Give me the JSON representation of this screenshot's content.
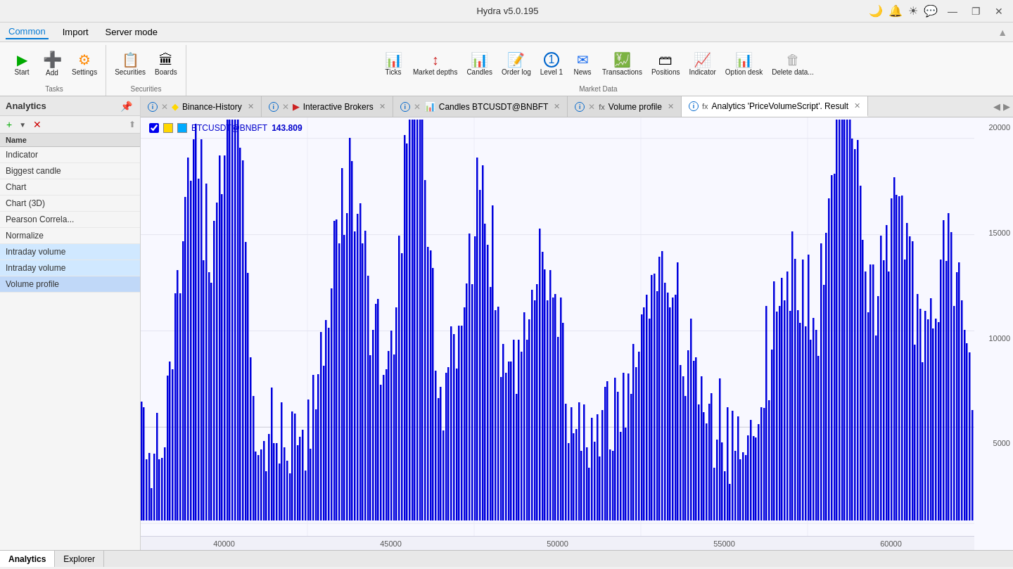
{
  "window": {
    "title": "Hydra v5.0.195"
  },
  "title_bar": {
    "icons": [
      "🌙",
      "🔔",
      "☀",
      "💬"
    ],
    "buttons": [
      "—",
      "❐",
      "✕"
    ]
  },
  "menu": {
    "items": [
      "Common",
      "Import",
      "Server mode"
    ],
    "active": "Common",
    "collapse_icon": "▲"
  },
  "toolbar": {
    "groups": [
      {
        "label": "Tasks",
        "buttons": [
          {
            "label": "Start",
            "icon": "▶",
            "color": "#00aa00"
          },
          {
            "label": "Add",
            "icon": "➕",
            "color": "#00aa00"
          },
          {
            "label": "Settings",
            "icon": "⚙",
            "color": "#ff8800"
          }
        ]
      },
      {
        "label": "Securities",
        "buttons": [
          {
            "label": "Securities",
            "icon": "📋"
          },
          {
            "label": "Boards",
            "icon": "🏛"
          }
        ]
      },
      {
        "label": "Market Data",
        "buttons": [
          {
            "label": "Ticks",
            "icon": "📊"
          },
          {
            "label": "Market depths",
            "icon": "📉"
          },
          {
            "label": "Candles",
            "icon": "📊"
          },
          {
            "label": "Order log",
            "icon": "📝"
          },
          {
            "label": "Level 1",
            "icon": "ℹ"
          },
          {
            "label": "News",
            "icon": "✉"
          },
          {
            "label": "Transactions",
            "icon": "💹"
          },
          {
            "label": "Positions",
            "icon": "🗃"
          },
          {
            "label": "Indicator",
            "icon": "📈"
          },
          {
            "label": "Option desk",
            "icon": "📊"
          },
          {
            "label": "Delete data...",
            "icon": "🗑"
          }
        ]
      }
    ]
  },
  "sidebar": {
    "title": "Analytics",
    "items": [
      {
        "label": "Name",
        "type": "header"
      },
      {
        "label": "Indicator"
      },
      {
        "label": "Biggest candle"
      },
      {
        "label": "Chart"
      },
      {
        "label": "Chart (3D)"
      },
      {
        "label": "Pearson Correla..."
      },
      {
        "label": "Normalize"
      },
      {
        "label": "Intraday volume",
        "highlighted": true
      },
      {
        "label": "Intraday volume",
        "highlighted": true
      },
      {
        "label": "Volume profile",
        "selected": true
      }
    ]
  },
  "tabs": [
    {
      "label": "Binance-History",
      "icon": "ℹ",
      "color": "#ffd700",
      "active": false
    },
    {
      "label": "Interactive Brokers",
      "icon": "ℹ",
      "color": "#cc0000",
      "active": false
    },
    {
      "label": "Candles BTCUSDT@BNBFT",
      "icon": "ℹ",
      "color": "#ff4400",
      "active": false
    },
    {
      "label": "Volume profile",
      "icon": "ℹ",
      "color": "#555",
      "active": false
    },
    {
      "label": "Analytics 'PriceVolumeScript'. Result",
      "icon": "ℹ",
      "color": "#555",
      "active": true
    }
  ],
  "chart": {
    "symbol": "BTCUSDT@BNBFT",
    "value": "143.809",
    "y_labels": [
      "20000",
      "15000",
      "10000",
      "5000",
      ""
    ],
    "x_labels": [
      "40000",
      "45000",
      "50000",
      "55000",
      "60000"
    ]
  },
  "bottom_tabs": [
    {
      "label": "Analytics",
      "active": true
    },
    {
      "label": "Explorer",
      "active": false
    }
  ]
}
